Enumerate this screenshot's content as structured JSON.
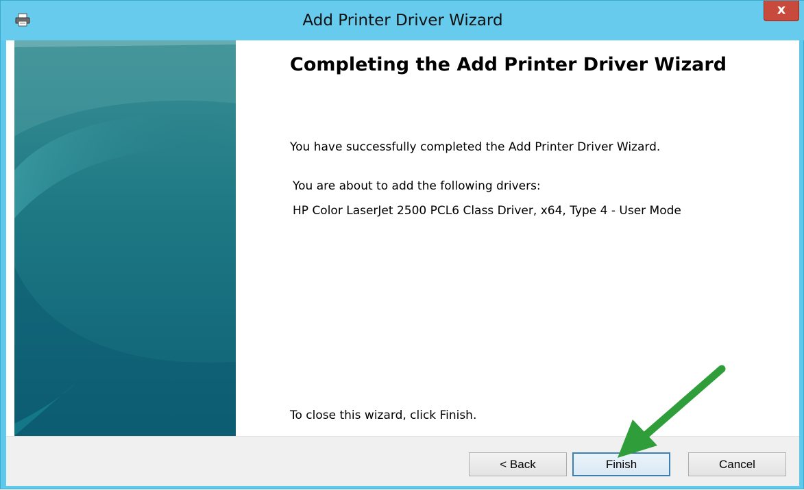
{
  "window": {
    "title": "Add Printer Driver Wizard",
    "close_label": "x"
  },
  "wizard": {
    "heading": "Completing the Add Printer Driver Wizard",
    "success_message": "You have successfully completed the Add Printer Driver Wizard.",
    "drivers_intro": "You are about to add the following drivers:",
    "driver_entry": "HP Color LaserJet 2500 PCL6 Class Driver, x64, Type 4 - User Mode",
    "close_hint": "To close this wizard, click Finish."
  },
  "buttons": {
    "back": "< Back",
    "finish": "Finish",
    "cancel": "Cancel"
  },
  "colors": {
    "titlebar": "#66cbec",
    "banner_teal": "#126f80",
    "close_red": "#c74a3c",
    "annotation_arrow": "#2f9e3a"
  },
  "icons": {
    "app": "printer-icon",
    "close": "close-icon",
    "annotation": "green-arrow-annotation"
  }
}
